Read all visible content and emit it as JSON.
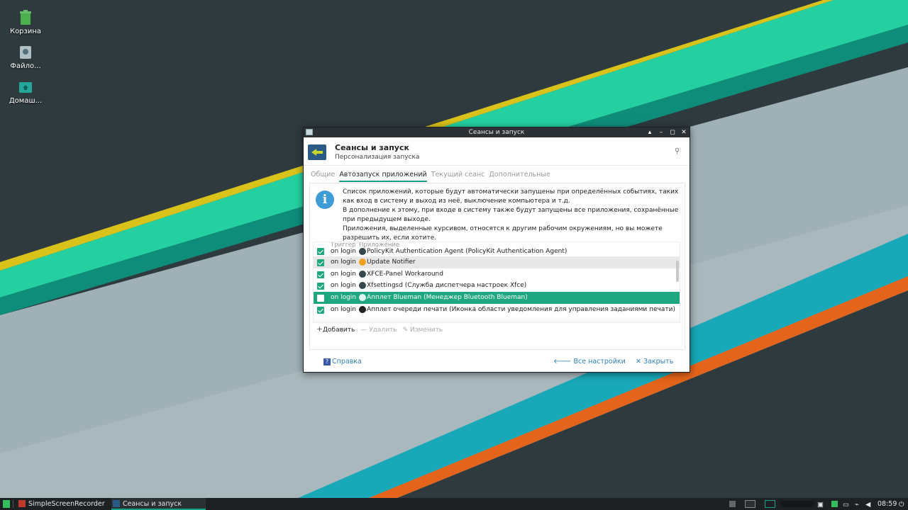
{
  "desktop": {
    "icons": [
      {
        "label": "Корзина",
        "icon": "trash-icon"
      },
      {
        "label": "Файло...",
        "icon": "file-manager-icon"
      },
      {
        "label": "Домаш...",
        "icon": "home-folder-icon"
      }
    ]
  },
  "window": {
    "title": "Сеансы и запуск",
    "header_title": "Сеансы и запуск",
    "header_subtitle": "Персонализация запуска",
    "tabs": [
      {
        "label": "Общие",
        "active": false
      },
      {
        "label": "Автозапуск приложений",
        "active": true
      },
      {
        "label": "Текущий сеанс",
        "active": false
      },
      {
        "label": "Дополнительные",
        "active": false
      }
    ],
    "info_lines": [
      "Список приложений, которые будут автоматически запущены при определённых событиях, таких как вход в систему и выход из неё, выключение компьютера и т.д.",
      "В дополнение к этому, при входе в систему также будут запущены все приложения, сохранённые при предыдущем выходе.",
      "Приложения, выделенные курсивом, относятся к другим рабочим окружениям, но вы можете разрешить их, если хотите."
    ],
    "columns": {
      "trigger": "Триггер",
      "app": "Приложение"
    },
    "rows": [
      {
        "checked": true,
        "trigger": "on login",
        "name": "PolicyKit Authentication Agent (PolicyKit Authentication Agent)",
        "icon": "shield-icon"
      },
      {
        "checked": true,
        "trigger": "on login",
        "name": "Update Notifier",
        "icon": "update-icon"
      },
      {
        "checked": true,
        "trigger": "on login",
        "name": "XFCE-Panel Workaround",
        "icon": "gear-icon"
      },
      {
        "checked": true,
        "trigger": "on login",
        "name": "Xfsettingsd (Служба диспетчера настроек Xfce)",
        "icon": "gear-icon"
      },
      {
        "checked": false,
        "trigger": "on login",
        "name": "Апплет Blueman (Менеджер Bluetooth Blueman)",
        "icon": "bluetooth-icon"
      },
      {
        "checked": true,
        "trigger": "on login",
        "name": "Апплет очереди печати (Иконка области уведомления для управления заданиями печати)",
        "icon": "printer-icon"
      }
    ],
    "list_buttons": {
      "add": "Добавить",
      "remove": "Удалить",
      "edit": "Изменить"
    },
    "footer": {
      "help": "Справка",
      "all_settings": "Все настройки",
      "close": "Закрыть"
    }
  },
  "taskbar": {
    "tasks": [
      {
        "label": "SimpleScreenRecorder",
        "active": false
      },
      {
        "label": "Сеансы и запуск",
        "active": true
      }
    ],
    "clock": "08:59"
  },
  "colors": {
    "accent": "#1fa77f",
    "link": "#2d7fb4"
  }
}
